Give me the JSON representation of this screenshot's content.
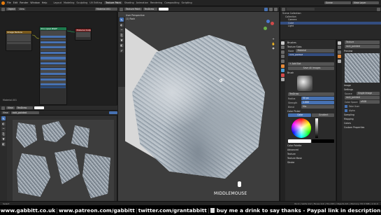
{
  "topbar": {
    "menus": [
      "File",
      "Edit",
      "Render",
      "Window",
      "Help"
    ],
    "workspaces": [
      "Layout",
      "Modeling",
      "Sculpting",
      "UV Editing",
      "Texture Paint",
      "Shading",
      "Animation",
      "Rendering",
      "Compositing",
      "Scripting"
    ],
    "active_workspace": "Texture Paint",
    "scene": "Scene",
    "view_layer": "View Layer"
  },
  "node_editor": {
    "mode_label": "Object",
    "nodes": [
      {
        "title": "Principled BSDF",
        "color": "#1d7a4d"
      },
      {
        "title": "Image Texture",
        "color": "#7a5a1d"
      },
      {
        "title": "Material Output",
        "color": "#7a1d1d"
      }
    ],
    "material_label": "Material.001"
  },
  "image_editor": {
    "brush_label": "TexDraw",
    "image_name": "rock_painted",
    "view_label": "View"
  },
  "viewport": {
    "mode": "Texture Paint",
    "view_label": "User Perspective",
    "object_label": "(1) Rock",
    "brush_label": "TexDraw",
    "overlay_text": "MIDDLEMOUSE"
  },
  "outliner": {
    "title": "Scene Collection",
    "items": [
      "Collection",
      "Camera",
      "Cube",
      "Light"
    ]
  },
  "tool_props": {
    "panels": [
      "Brushes",
      "Texture Slots",
      "Mode",
      "Material"
    ],
    "slot_label": "Material",
    "new_slot": "+ Add Slot",
    "save_button": "Save All Images",
    "brush_section": "Brush",
    "brush_name": "TexDraw",
    "fields": [
      {
        "label": "Radius",
        "value": "50 px"
      },
      {
        "label": "Strength",
        "value": "1.000"
      },
      {
        "label": "Blend",
        "value": "Mix"
      }
    ],
    "color_picker": "Color Picker",
    "tabs": [
      "Color",
      "Gradient"
    ],
    "sections": [
      "Color Palette",
      "Advanced",
      "Texture",
      "Texture Mask",
      "Stroke",
      "Falloff",
      "Cursor"
    ]
  },
  "texture_props": {
    "name": "Texture",
    "image_name": "rock_painted",
    "section_preview": "Preview",
    "sections": [
      "Image",
      "Settings",
      "Sampling",
      "Mapping",
      "Colors",
      "Custom Properties"
    ],
    "source_label": "Source",
    "source_value": "Single Image",
    "color_space_label": "Color Space",
    "color_space_value": "sRGB",
    "alpha_label": "Alpha",
    "fake_user": "Fake User"
  },
  "statusbar": {
    "left": "Select",
    "right": "Rock | Verts:112 | Faces:110 | Tris:220 | Objects:0/1 | Memory: 55.5 MiB | 2.91.0"
  },
  "footer": {
    "site": "www.gabbitt.co.uk",
    "patreon": "www.patreon.com/gabbitt",
    "twitter": "twitter.com/grantabbitt",
    "drink": "buy me a drink to say thanks - Paypal link in description"
  },
  "colors": {
    "accent": "#4772b3",
    "background": "#1d1d1d",
    "header": "#2b2b2b"
  }
}
